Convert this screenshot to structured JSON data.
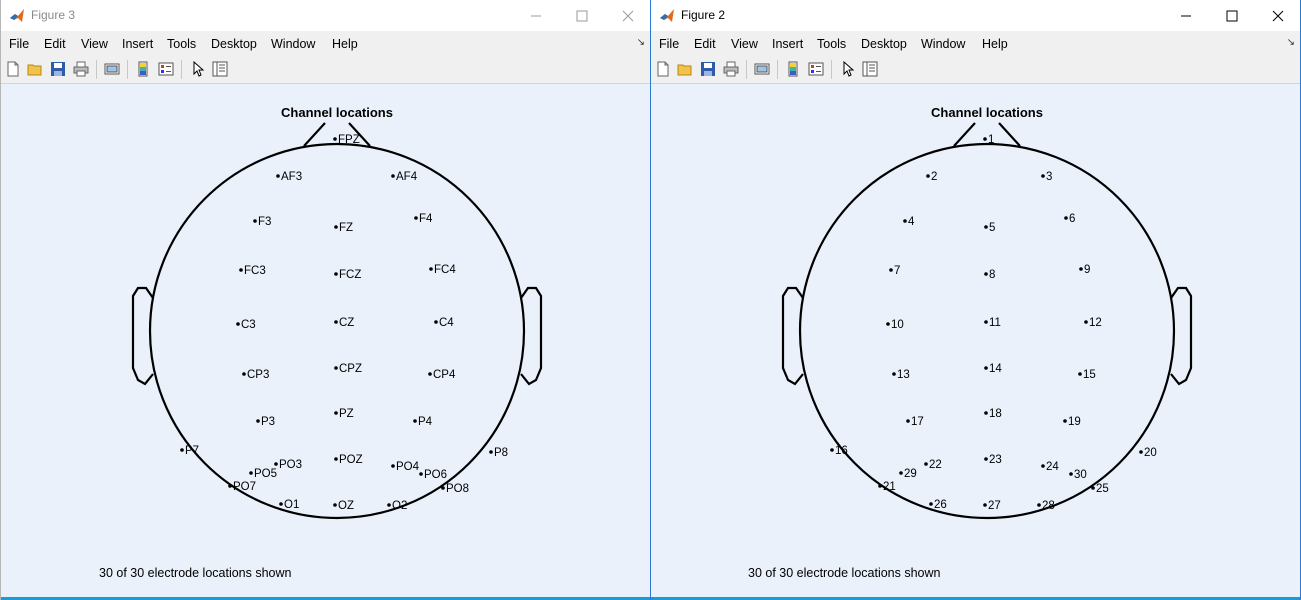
{
  "windows": [
    {
      "id": "left",
      "title": "Figure 3",
      "active": false,
      "menus": [
        "File",
        "Edit",
        "View",
        "Insert",
        "Tools",
        "Desktop",
        "Window",
        "Help"
      ],
      "menu_overflow": "↘",
      "plot_title": "Channel locations",
      "status": "30 of 30 electrode locations shown"
    },
    {
      "id": "right",
      "title": "Figure 2",
      "active": true,
      "menus": [
        "File",
        "Edit",
        "View",
        "Insert",
        "Tools",
        "Desktop",
        "Window",
        "Help"
      ],
      "menu_overflow": "↘",
      "plot_title": "Channel locations",
      "status": "30 of 30 electrode locations shown"
    }
  ],
  "toolbar_icons": [
    "new-figure-icon",
    "open-file-icon",
    "save-icon",
    "print-icon",
    "link-plot-icon",
    "insert-colorbar-icon",
    "insert-legend-icon",
    "edit-plot-icon",
    "property-inspector-icon"
  ],
  "electrodes": [
    {
      "name": "FPZ",
      "number": "1"
    },
    {
      "name": "AF3",
      "number": "2"
    },
    {
      "name": "AF4",
      "number": "3"
    },
    {
      "name": "F3",
      "number": "4"
    },
    {
      "name": "FZ",
      "number": "5"
    },
    {
      "name": "F4",
      "number": "6"
    },
    {
      "name": "FC3",
      "number": "7"
    },
    {
      "name": "FCZ",
      "number": "8"
    },
    {
      "name": "FC4",
      "number": "9"
    },
    {
      "name": "C3",
      "number": "10"
    },
    {
      "name": "CZ",
      "number": "11"
    },
    {
      "name": "C4",
      "number": "12"
    },
    {
      "name": "CP3",
      "number": "13"
    },
    {
      "name": "CPZ",
      "number": "14"
    },
    {
      "name": "CP4",
      "number": "15"
    },
    {
      "name": "P7",
      "number": "16"
    },
    {
      "name": "P3",
      "number": "17"
    },
    {
      "name": "PZ",
      "number": "18"
    },
    {
      "name": "P4",
      "number": "19"
    },
    {
      "name": "P8",
      "number": "20"
    },
    {
      "name": "PO7",
      "number": "21"
    },
    {
      "name": "PO3",
      "number": "22"
    },
    {
      "name": "POZ",
      "number": "23"
    },
    {
      "name": "PO4",
      "number": "24"
    },
    {
      "name": "PO8",
      "number": "25"
    },
    {
      "name": "O1",
      "number": "26"
    },
    {
      "name": "OZ",
      "number": "27"
    },
    {
      "name": "O2",
      "number": "28"
    },
    {
      "name": "PO5",
      "number": "29"
    },
    {
      "name": "PO6",
      "number": "30"
    }
  ],
  "colors": {
    "figure_background": "#eaf1fb",
    "head_outline": "#000000",
    "active_border": "#2a7ad3",
    "taskbar_line": "#1a9bd7"
  }
}
